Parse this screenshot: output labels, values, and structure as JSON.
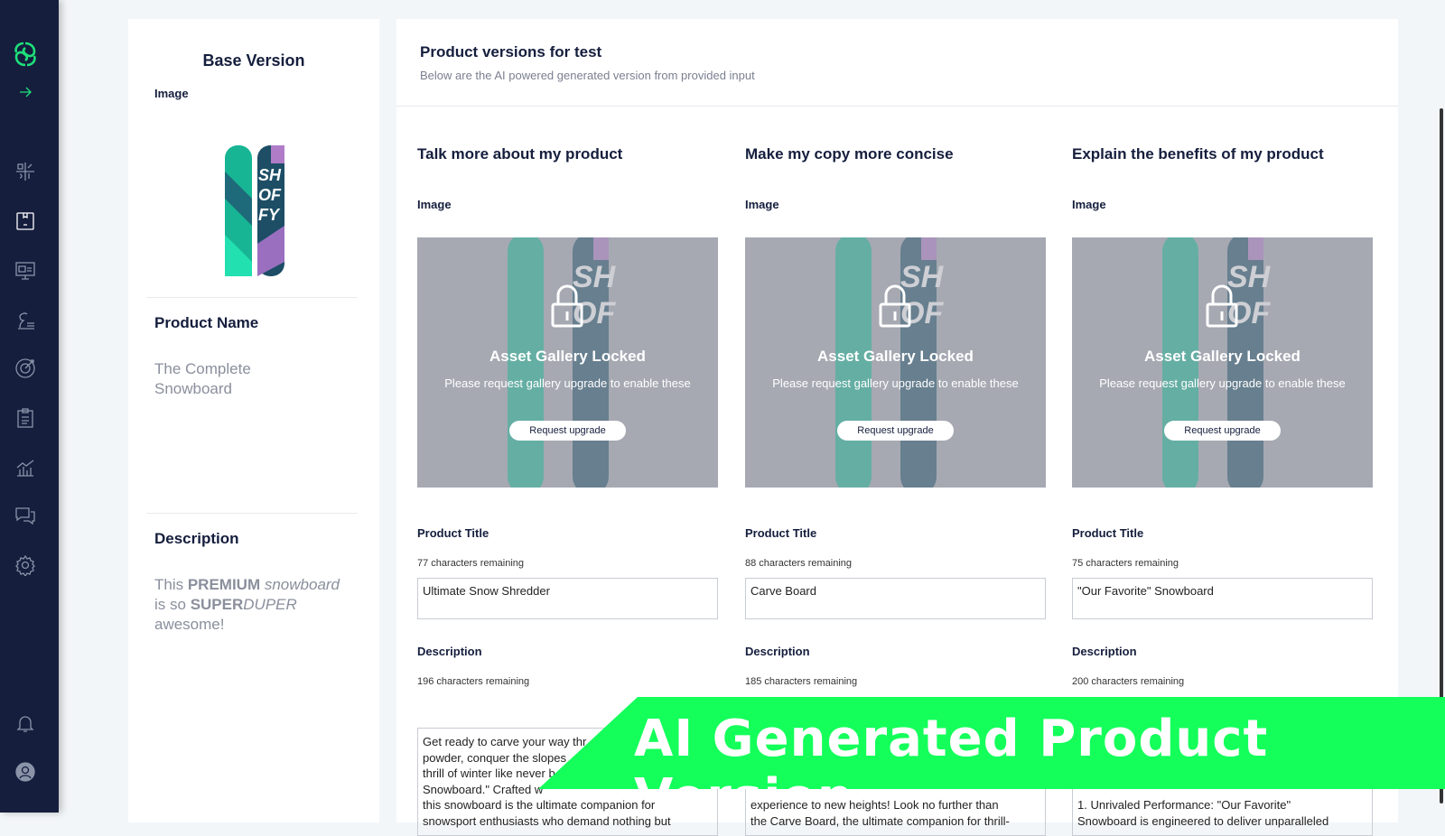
{
  "sidebar": {
    "icons": [
      "logo-icon",
      "expand-arrow-icon",
      "marketing-mix-icon",
      "product-box-icon",
      "display-ad-icon",
      "strategy-chess-icon",
      "target-icon",
      "clipboard-icon",
      "analytics-chart-icon",
      "chat-icon",
      "settings-gear-icon",
      "bell-icon",
      "user-avatar-icon"
    ],
    "accent": "#1ee07a"
  },
  "base": {
    "title": "Base Version",
    "image_label": "Image",
    "product_name_label": "Product Name",
    "product_name": "The Complete Snowboard",
    "description_label": "Description",
    "description_parts": [
      "This ",
      "PREMIUM",
      " snowboard",
      " is so ",
      "SUPER",
      "DUPER",
      " awesome!"
    ]
  },
  "header": {
    "title": "Product versions for test",
    "subtitle": "Below are the AI powered generated version from provided input"
  },
  "versions": [
    {
      "heading": "Talk more about my product",
      "image_label": "Image",
      "locked_title": "Asset Gallery Locked",
      "locked_msg": "Please request gallery upgrade to enable these",
      "upgrade": "Request upgrade",
      "title_label": "Product Title",
      "title_remaining": "77 characters remaining",
      "title_value": "Ultimate Snow Shredder",
      "desc_label": "Description",
      "desc_remaining": "196 characters remaining",
      "desc_value": "Get ready to carve your way thr\npowder, conquer the slopes\nthrill of winter like never b\nSnowboard.\" Crafted w\nthis snowboard is the ultimate companion for\nsnowsport enthusiasts who demand nothing but"
    },
    {
      "heading": "Make my copy more concise",
      "image_label": "Image",
      "locked_title": "Asset Gallery Locked",
      "locked_msg": "Please request gallery upgrade to enable these",
      "upgrade": "Request upgrade",
      "title_label": "Product Title",
      "title_remaining": "88 characters remaining",
      "title_value": "Carve Board",
      "desc_label": "Description",
      "desc_remaining": "185 characters remaining",
      "desc_value": "\n\n\n\nexperience to new heights! Look no further than\nthe Carve Board, the ultimate companion for thrill-"
    },
    {
      "heading": "Explain the benefits of my product",
      "image_label": "Image",
      "locked_title": "Asset Gallery Locked",
      "locked_msg": "Please request gallery upgrade to enable these",
      "upgrade": "Request upgrade",
      "title_label": "Product Title",
      "title_remaining": "75 characters remaining",
      "title_value": "\"Our Favorite\" Snowboard",
      "desc_label": "Description",
      "desc_remaining": "200 characters remaining",
      "desc_value": "\n\n\n\n1. Unrivaled Performance: \"Our Favorite\"\nSnowboard is engineered to deliver unparalleled"
    }
  ],
  "banner": {
    "text": "AI Generated Product Version",
    "color": "#14ff5a"
  }
}
